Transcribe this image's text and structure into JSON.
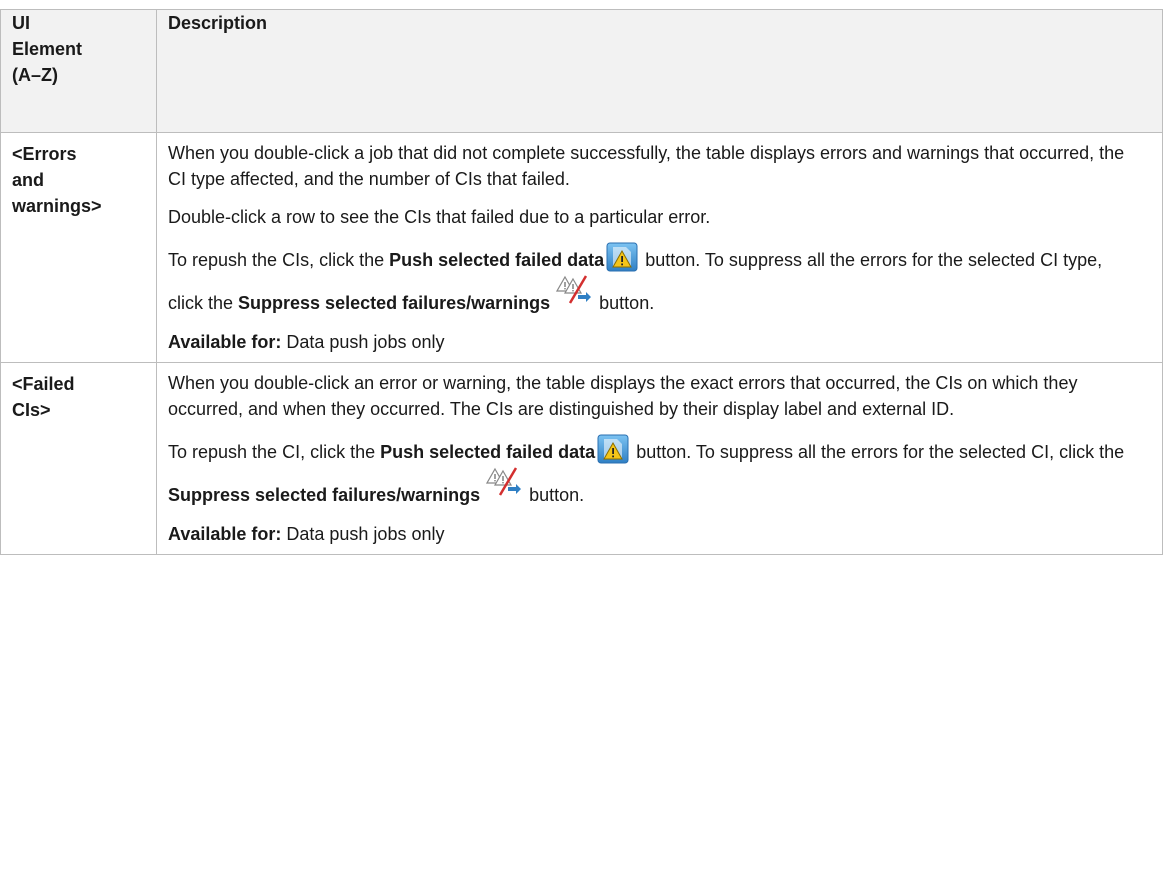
{
  "table": {
    "header": {
      "col1": "UI Element (A–Z)",
      "col1_lines": [
        "UI",
        "Element",
        "(A–Z)"
      ],
      "col2": "Description"
    },
    "rows": [
      {
        "term_lines": [
          "<Errors",
          "and",
          "warnings>"
        ],
        "p1": "When you double-click a job that did not complete successfully, the table displays errors and warnings that occurred, the CI type affected, and the number of CIs that failed.",
        "p2": "Double-click a row to see the CIs that failed due to a particular error.",
        "p3_pre": "To repush the CIs, click the ",
        "p3_bold1": "Push selected failed data",
        "p3_mid": " button. To suppress all the errors for the selected CI type, click the ",
        "p3_bold2": "Suppress selected failures/warnings",
        "p3_post": " button.",
        "avail_label": "Available for:",
        "avail_value": " Data push jobs only"
      },
      {
        "term_lines": [
          "<Failed",
          "CIs>"
        ],
        "p1": "When you double-click an error or warning, the table displays the exact errors that occurred, the CIs on which they occurred, and when they occurred. The CIs are distinguished by their display label and external ID.",
        "p3_pre": "To repush the CI, click the ",
        "p3_bold1": "Push selected failed data",
        "p3_mid": " button. To suppress all the errors for the selected CI, click the ",
        "p3_bold2": "Suppress selected failures/warnings",
        "p3_post": " button.",
        "avail_label": "Available for:",
        "avail_value": " Data push jobs only"
      }
    ]
  },
  "icons": {
    "push": "push-selected-failed-data-icon",
    "suppress": "suppress-selected-failures-warnings-icon"
  },
  "colors": {
    "header_bg": "#f2f2f2",
    "border": "#bdbdbd",
    "text": "#1a1a1a",
    "push_icon_blue": "#3a8fd6",
    "warning_yellow": "#f5c518"
  }
}
